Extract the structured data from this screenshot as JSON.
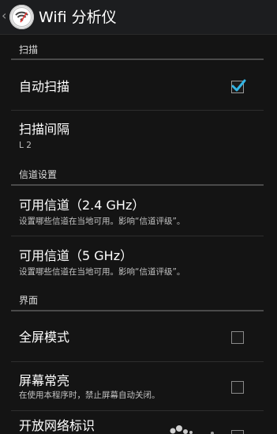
{
  "app": {
    "up_caret": "‹",
    "title": "Wifi 分析仪",
    "icon": "wifi-analyzer-app-icon"
  },
  "sections": {
    "scan": {
      "header": "扫描",
      "auto_scan": {
        "title": "自动扫描",
        "checked": true
      },
      "scan_interval": {
        "title": "扫描间隔",
        "value": "L 2"
      }
    },
    "channel": {
      "header": "信道设置",
      "channels_24": {
        "title": "可用信道（2.4 GHz）",
        "summary": "设置哪些信道在当地可用。影响“信道评级”。"
      },
      "channels_5": {
        "title": "可用信道（5 GHz）",
        "summary": "设置哪些信道在当地可用。影响“信道评级”。"
      }
    },
    "ui": {
      "header": "界面",
      "fullscreen": {
        "title": "全屏模式",
        "checked": false
      },
      "keep_screen_on": {
        "title": "屏幕常亮",
        "summary": "在使用本程序时，禁止屏幕自动关闭。",
        "checked": false
      },
      "open_network_marker": {
        "title": "开放网络标识",
        "checked": false
      }
    }
  },
  "colors": {
    "accent": "#33b5e5",
    "background": "#141414",
    "action_bar": "#1c1d1f"
  }
}
